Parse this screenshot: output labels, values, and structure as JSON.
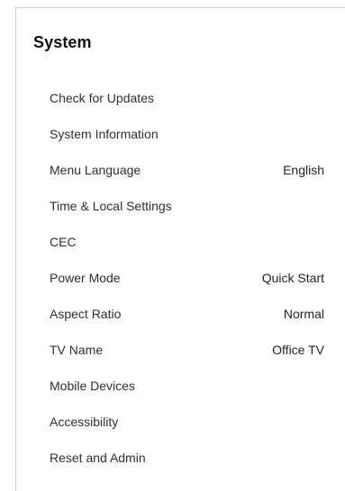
{
  "panel": {
    "title": "System"
  },
  "menu": {
    "items": [
      {
        "label": "Check for Updates",
        "value": ""
      },
      {
        "label": "System Information",
        "value": ""
      },
      {
        "label": "Menu Language",
        "value": "English"
      },
      {
        "label": "Time & Local Settings",
        "value": ""
      },
      {
        "label": "CEC",
        "value": ""
      },
      {
        "label": "Power Mode",
        "value": "Quick Start"
      },
      {
        "label": "Aspect Ratio",
        "value": "Normal"
      },
      {
        "label": "TV Name",
        "value": "Office TV"
      },
      {
        "label": "Mobile Devices",
        "value": ""
      },
      {
        "label": "Accessibility",
        "value": ""
      },
      {
        "label": "Reset and Admin",
        "value": ""
      }
    ]
  }
}
